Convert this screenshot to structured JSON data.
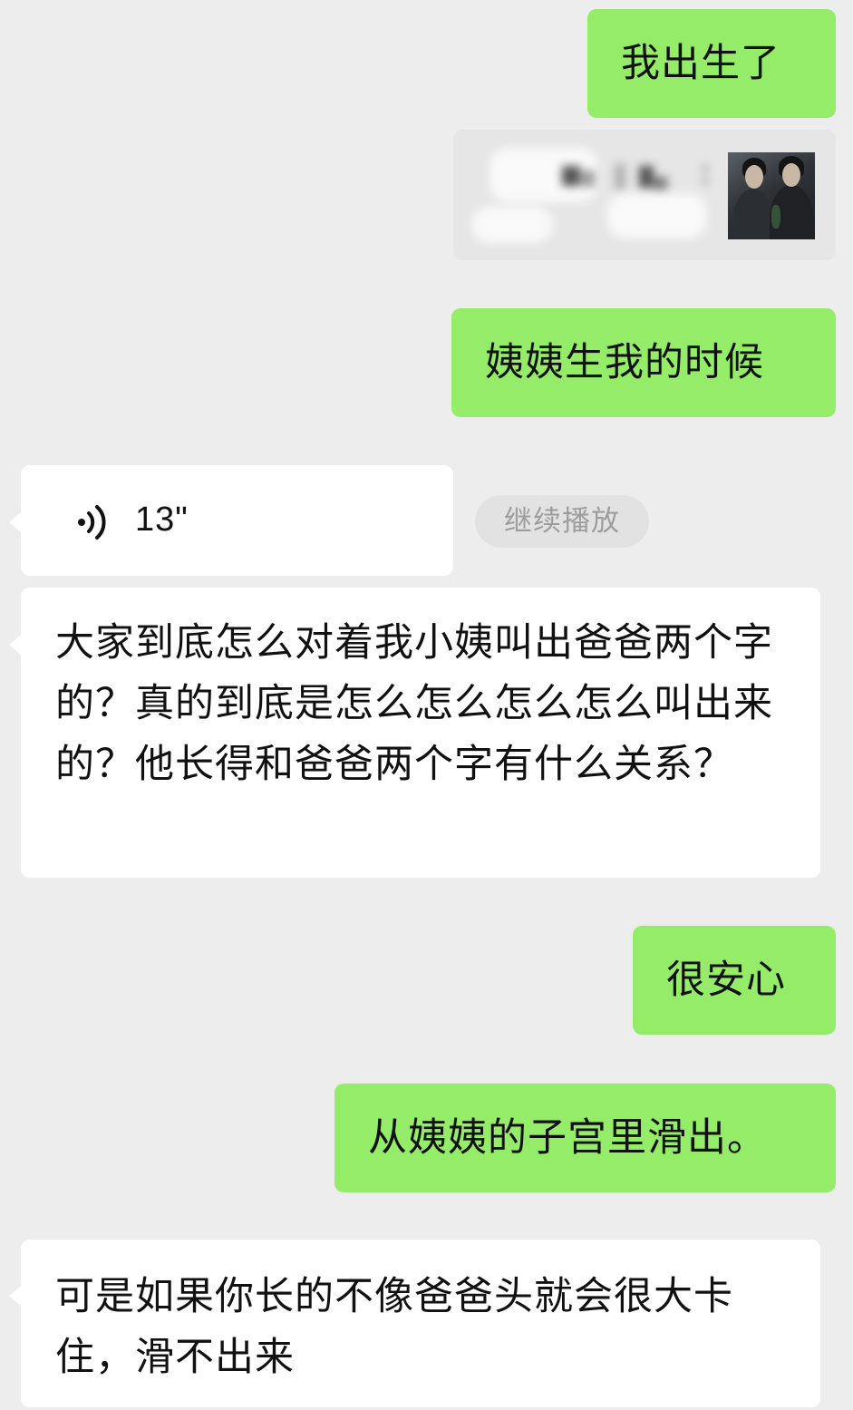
{
  "colors": {
    "background": "#ededed",
    "outgoing_bubble": "#95ec69",
    "incoming_bubble": "#ffffff",
    "continue_button_bg": "#e2e2e2",
    "continue_button_text": "#9d9d9d"
  },
  "messages": [
    {
      "type": "text",
      "direction": "outgoing",
      "text": "我出生了"
    },
    {
      "type": "card",
      "direction": "outgoing",
      "blurred": true,
      "thumbnail": "photo-of-two-men"
    },
    {
      "type": "text",
      "direction": "outgoing",
      "text": "姨姨生我的时候"
    },
    {
      "type": "voice",
      "direction": "incoming",
      "duration": "13\"",
      "icon": "voice-wave-icon",
      "action_label": "继续播放"
    },
    {
      "type": "text",
      "direction": "incoming",
      "text": "大家到底怎么对着我小姨叫出爸爸两个字的？真的到底是怎么怎么怎么怎么叫出来的？他长得和爸爸两个字有什么关系？"
    },
    {
      "type": "text",
      "direction": "outgoing",
      "text": "很安心"
    },
    {
      "type": "text",
      "direction": "outgoing",
      "text": "从姨姨的子宫里滑出。"
    },
    {
      "type": "text",
      "direction": "incoming",
      "text": "可是如果你长的不像爸爸头就会很大卡住，滑不出来"
    }
  ]
}
